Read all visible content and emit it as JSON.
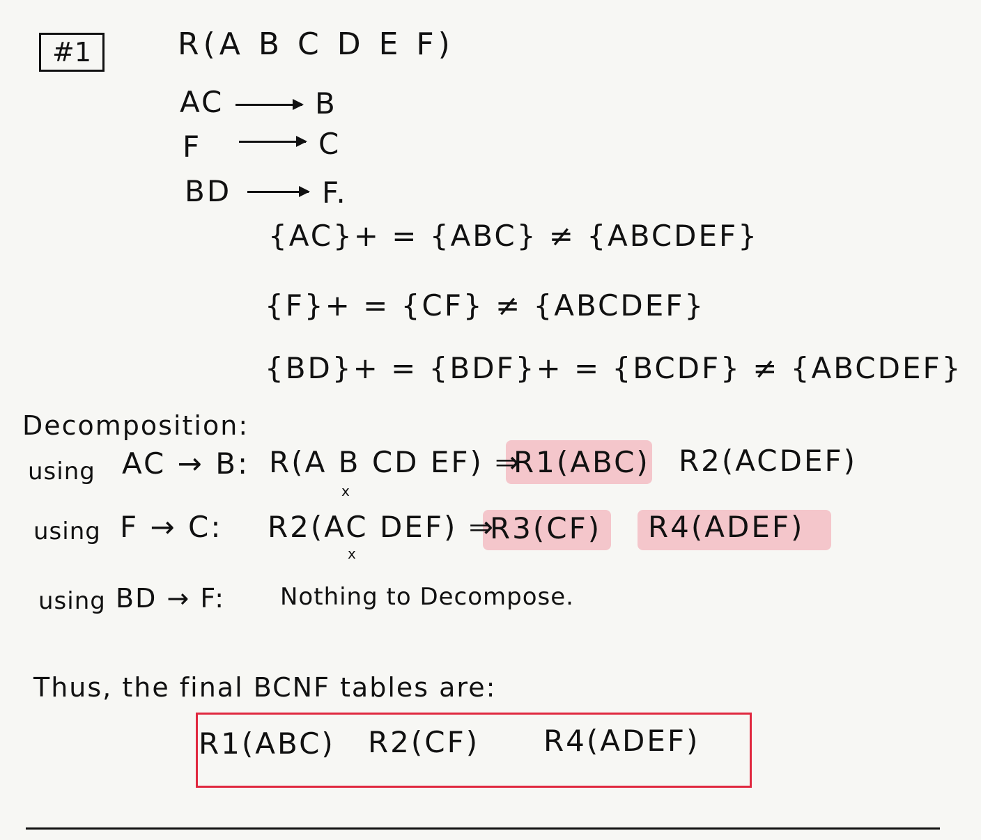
{
  "header": {
    "problem_label": "#1",
    "relation": "R(A B C D E F)"
  },
  "fds": [
    {
      "lhs": "AC",
      "rhs": "B"
    },
    {
      "lhs": "F",
      "rhs": "C"
    },
    {
      "lhs": "BD",
      "rhs": "F."
    }
  ],
  "closures": [
    "{AC}+ = {ABC} ≠ {ABCDEF}",
    "{F}+ = {CF} ≠ {ABCDEF}",
    "{BD}+ = {BDF}+ = {BCDF} ≠ {ABCDEF}"
  ],
  "decomposition": {
    "heading": "Decomposition:",
    "steps": [
      {
        "using": "using",
        "fd": "AC → B:",
        "relation": "R(A B CD EF) ⇒",
        "results": [
          "R1(ABC)",
          "R2(ACDEF)"
        ],
        "x_mark": "x"
      },
      {
        "using": "using",
        "fd": "F → C:",
        "relation": "R2(AC DEF) ⇒",
        "results": [
          "R3(CF)",
          "R4(ADEF)"
        ],
        "x_mark": "x"
      },
      {
        "using": "using",
        "fd": "BD → F:",
        "note": "Nothing to Decompose."
      }
    ]
  },
  "conclusion": {
    "text": "Thus, the final BCNF tables are:",
    "tables": [
      "R1(ABC)",
      "R2(CF)",
      "R4(ADEF)"
    ]
  }
}
